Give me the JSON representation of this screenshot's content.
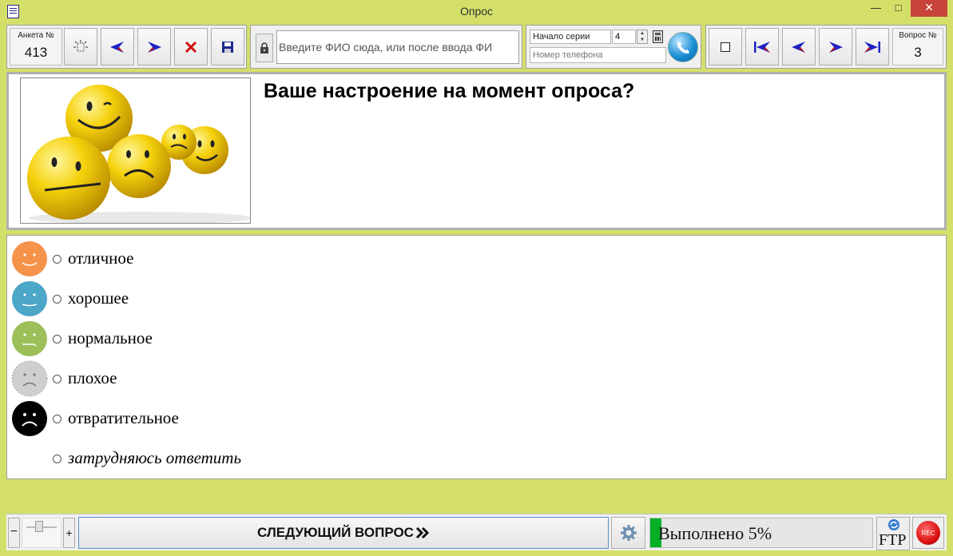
{
  "window": {
    "title": "Опрос",
    "icon": "list-window-icon",
    "controls": [
      "minimize-icon",
      "maximize-icon",
      "close-icon"
    ]
  },
  "toolbar_left": {
    "form_label": "Анкета №",
    "form_number": "413",
    "buttons": [
      "new-form-icon",
      "prev-form-icon",
      "next-form-icon",
      "delete-icon",
      "save-icon"
    ]
  },
  "name_input": {
    "value": "Введите ФИО сюда, или после ввода ФИ",
    "lock_icon": "lock-icon"
  },
  "series": {
    "label": "Начало серии",
    "value": "4",
    "phone_placeholder": "Номер телефона",
    "calculator_icon": "calculator-icon",
    "call_icon": "phone-call-icon"
  },
  "toolbar_right": {
    "question_label": "Вопрос №",
    "question_number": "3",
    "buttons": [
      "stop-icon",
      "first-question-icon",
      "prev-question-icon",
      "next-question-icon",
      "last-question-icon"
    ]
  },
  "question": {
    "text": "Ваше настроение на момент опроса?",
    "image": "smiley-faces-image"
  },
  "answers": [
    {
      "label": "отличное",
      "icon": "excellent-smiley-icon",
      "color": "#f5934a",
      "italic": false
    },
    {
      "label": "хорошее",
      "icon": "good-smiley-icon",
      "color": "#4ba6c8",
      "italic": false
    },
    {
      "label": "нормальное",
      "icon": "normal-smiley-icon",
      "color": "#9cbf5a",
      "italic": false
    },
    {
      "label": "плохое",
      "icon": "bad-smiley-icon",
      "color": "#cfcfcf",
      "italic": false
    },
    {
      "label": "отвратительное",
      "icon": "awful-smiley-icon",
      "color": "#000000",
      "italic": false
    },
    {
      "label": "затрудняюсь ответить",
      "icon": "",
      "color": "",
      "italic": true
    }
  ],
  "bottom": {
    "zoom_minus": "−",
    "zoom_plus": "+",
    "next_button": "СЛЕДУЮЩИЙ ВОПРОС",
    "next_icon": "double-chevron-right-icon",
    "settings_icon": "gear-icon",
    "progress_label": "Выполнено 5%",
    "progress_value": 0.05,
    "ftp_label": "FTP",
    "rec_label": "REC"
  },
  "colors": {
    "window_chrome": "#d4df6a",
    "close_button": "#c7443a",
    "progress_fill": "#06b025",
    "arrow_blue": "#1e22c4",
    "arrow_red": "#c81515"
  }
}
